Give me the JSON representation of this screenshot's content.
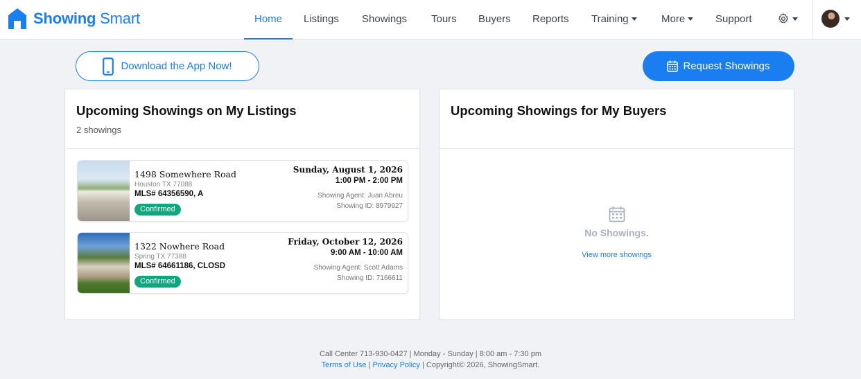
{
  "brand": {
    "name_bold": "Showing",
    "name_light": " Smart",
    "accent": "#1a7ef0"
  },
  "nav": {
    "items": [
      {
        "label": "Home",
        "active": true
      },
      {
        "label": "Listings"
      },
      {
        "label": "Showings"
      },
      {
        "label": "Tours"
      },
      {
        "label": "Buyers"
      },
      {
        "label": "Reports"
      },
      {
        "label": "Training",
        "dropdown": true
      },
      {
        "label": "More",
        "dropdown": true
      },
      {
        "label": "Support"
      }
    ],
    "settings_icon": "gear-icon",
    "avatar_icon": "user-avatar"
  },
  "actions": {
    "download_label": "Download the App Now!",
    "request_label": "Request Showings"
  },
  "listings_panel": {
    "title": "Upcoming Showings on My Listings",
    "count": "2 showings",
    "showings": [
      {
        "address": "1498 Somewhere Road",
        "city": "Houston TX 77088",
        "mls": "MLS# 64356590, A",
        "status": "Confirmed",
        "date": "Sunday, August 1, 2026",
        "time": "1:00 PM - 2:00 PM",
        "agent": "Showing Agent: Juan Abreu",
        "showing_id": "Showing ID: 8979927"
      },
      {
        "address": "1322 Nowhere Road",
        "city": "Spring TX 77388",
        "mls": "MLS# 64661186, CLOSD",
        "status": "Confirmed",
        "date": "Friday, October 12, 2026",
        "time": "9:00 AM - 10:00 AM",
        "agent": "Showing Agent: Scott Adams",
        "showing_id": "Showing ID: 7166611"
      }
    ]
  },
  "buyers_panel": {
    "title": "Upcoming Showings for My Buyers",
    "empty_title": "No Showings.",
    "empty_link": "View more showings"
  },
  "footer": {
    "line1": "Call Center 713-930-0427 | Monday - Sunday | 8:00 am - 7:30 pm",
    "terms": "Terms of Use",
    "sep": " | ",
    "privacy": "Privacy Policy",
    "copyright": " | Copyright© 2026, ShowingSmart."
  },
  "colors": {
    "primary": "#1a7ef0",
    "confirmed": "#11a67d",
    "background": "#f1f2f5"
  }
}
